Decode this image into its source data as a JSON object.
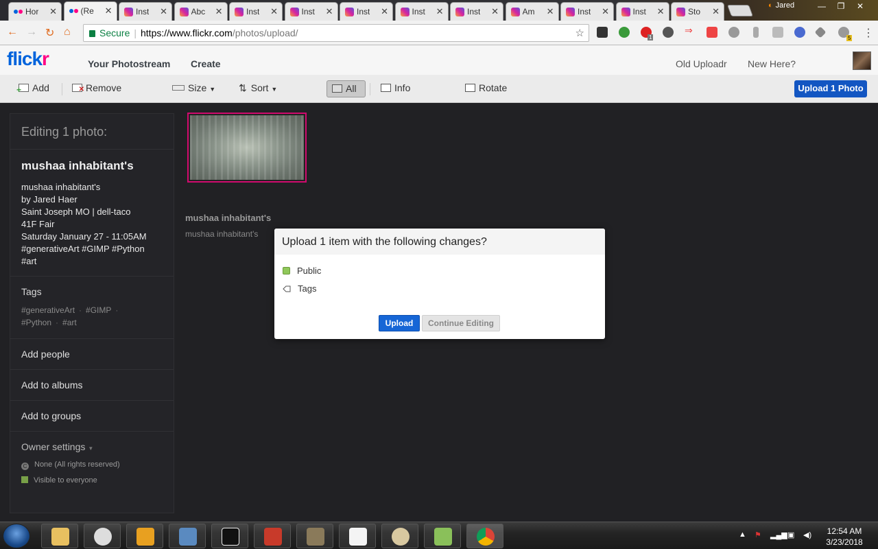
{
  "browser": {
    "tabs": [
      {
        "title": "Hor",
        "icon": "flickr-icon",
        "active": false
      },
      {
        "title": "(Re",
        "icon": "flickr-icon",
        "active": true
      },
      {
        "title": "Inst",
        "icon": "instagram-icon",
        "active": false
      },
      {
        "title": "Abc",
        "icon": "instagram-icon",
        "active": false
      },
      {
        "title": "Inst",
        "icon": "instagram-icon",
        "active": false
      },
      {
        "title": "Inst",
        "icon": "instagram-icon",
        "active": false
      },
      {
        "title": "Inst",
        "icon": "instagram-icon",
        "active": false
      },
      {
        "title": "Inst",
        "icon": "instagram-icon",
        "active": false
      },
      {
        "title": "Inst",
        "icon": "instagram-icon",
        "active": false
      },
      {
        "title": "Am",
        "icon": "instagram-icon",
        "active": false
      },
      {
        "title": "Inst",
        "icon": "instagram-icon",
        "active": false
      },
      {
        "title": "Inst",
        "icon": "instagram-icon",
        "active": false
      },
      {
        "title": "Sto",
        "icon": "instagram-icon",
        "active": false
      }
    ],
    "user": "Jared",
    "secure_label": "Secure",
    "url_host": "https://www.flickr.com",
    "url_path": "/photos/upload/",
    "extension_badge": "1",
    "extension_badge2": "5"
  },
  "header": {
    "logo_a": "flick",
    "logo_b": "r",
    "nav_photostream": "Your Photostream",
    "nav_create": "Create",
    "old_uploadr": "Old Uploadr",
    "new_here": "New Here?"
  },
  "uploadr_toolbar": {
    "add": "Add",
    "remove": "Remove",
    "size": "Size",
    "sort": "Sort",
    "all": "All",
    "info": "Info",
    "rotate": "Rotate",
    "upload_button": "Upload 1 Photo"
  },
  "panel": {
    "editing_title": "Editing 1 photo:",
    "photo_title": "mushaa inhabitant's",
    "description_lines": [
      "mushaa inhabitant's",
      "by Jared Haer",
      "Saint Joseph MO | dell-taco",
      "41F Fair",
      "Saturday January 27 - 11:05AM",
      "#generativeArt #GIMP #Python",
      "#art"
    ],
    "tags_heading": "Tags",
    "tags": [
      "#generativeArt",
      "#GIMP",
      "#Python",
      "#art"
    ],
    "add_people": "Add people",
    "add_albums": "Add to albums",
    "add_groups": "Add to groups",
    "owner_settings": "Owner settings",
    "license": "None (All rights reserved)",
    "visibility": "Visible to everyone"
  },
  "photo": {
    "title": "mushaa inhabitant's",
    "description": "mushaa inhabitant's"
  },
  "modal": {
    "title": "Upload 1 item with the following changes?",
    "change_public": "Public",
    "change_tags": "Tags",
    "upload_button": "Upload",
    "continue_button": "Continue Editing"
  },
  "taskbar": {
    "time": "12:54 AM",
    "date": "3/23/2018"
  },
  "colors": {
    "flickr_blue": "#0063dc",
    "flickr_pink": "#ff0084",
    "primary_button": "#1356c2",
    "public_green": "#90c85a"
  }
}
